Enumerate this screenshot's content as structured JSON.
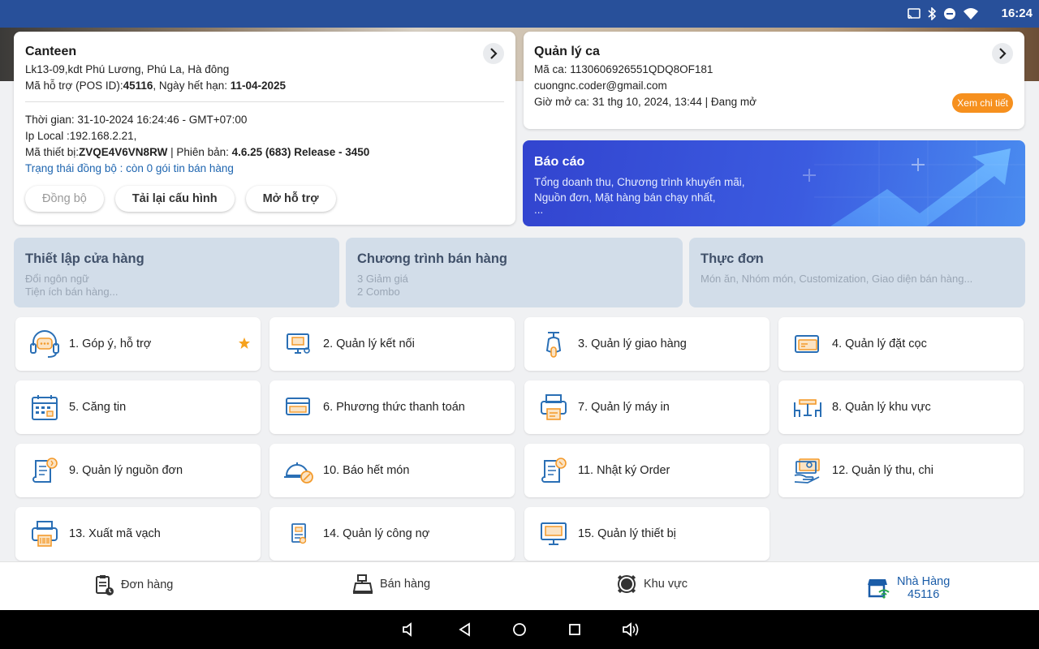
{
  "status": {
    "time": "16:24"
  },
  "canteen": {
    "title": "Canteen",
    "address": "Lk13-09,kdt Phú Lương,  Phú La,  Hà đông",
    "support_prefix": "Mã hỗ trợ (POS ID):",
    "support_id": "45116",
    "expiry_prefix": ", Ngày hết hạn: ",
    "expiry": "11-04-2025",
    "time_line": "Thời gian: 31-10-2024 16:24:46 - GMT+07:00",
    "ip_line": "Ip Local :192.168.2.21,",
    "device_prefix": "Mã thiết bị:",
    "device_id": "ZVQE4V6VN8RW",
    "version_prefix": " | Phiên bản: ",
    "version": "4.6.25 (683) Release - 3450",
    "sync_status": "Trạng thái đồng bộ : còn 0 gói tin bán hàng",
    "buttons": {
      "sync": "Đồng bộ",
      "reload": "Tải lại cấu hình",
      "support": "Mở hỗ trợ"
    }
  },
  "shift": {
    "title": "Quản lý ca",
    "code": "Mã ca: 1130606926551QDQ8OF181",
    "email": "cuongnc.coder@gmail.com",
    "opened": "Giờ mở ca: 31 thg 10, 2024, 13:44 | Đang mở",
    "detail_button": "Xem chi tiết"
  },
  "report": {
    "title": "Báo cáo",
    "line1": "Tổng doanh thu, Chương trình khuyến mãi,",
    "line2": "Nguồn đơn, Mặt hàng bán chạy nhất,",
    "line3": "..."
  },
  "tiles": [
    {
      "title": "Thiết lập cửa hàng",
      "sub1": "Đổi ngôn ngữ",
      "sub2": "Tiện ích bán hàng..."
    },
    {
      "title": "Chương trình bán hàng",
      "sub1": "3 Giảm giá",
      "sub2": "2 Combo"
    },
    {
      "title": "Thực đơn",
      "sub1": "Món ăn,  Nhóm món,  Customization,  Giao diện bán hàng...",
      "sub2": ""
    }
  ],
  "menu": [
    {
      "label": "1. Góp ý, hỗ trợ",
      "icon": "headset-icon"
    },
    {
      "label": "2. Quản lý kết nối",
      "icon": "monitor-connection-icon"
    },
    {
      "label": "3. Quản lý giao hàng",
      "icon": "scooter-icon"
    },
    {
      "label": "4. Quản lý đặt cọc",
      "icon": "deposit-card-icon"
    },
    {
      "label": "5. Căng tin",
      "icon": "calendar-icon"
    },
    {
      "label": "6. Phương thức thanh toán",
      "icon": "payment-card-icon"
    },
    {
      "label": "7. Quản lý máy in",
      "icon": "printer-icon"
    },
    {
      "label": "8. Quản lý khu vực",
      "icon": "table-chairs-icon"
    },
    {
      "label": "9. Quản lý nguồn đơn",
      "icon": "order-source-icon"
    },
    {
      "label": "10. Báo hết món",
      "icon": "cloche-cancel-icon"
    },
    {
      "label": "11. Nhật ký Order",
      "icon": "order-log-icon"
    },
    {
      "label": "12. Quản lý thu, chi",
      "icon": "cash-hand-icon"
    },
    {
      "label": "13. Xuất mã vạch",
      "icon": "barcode-printer-icon"
    },
    {
      "label": "14. Quản lý công nợ",
      "icon": "debt-document-icon"
    },
    {
      "label": "15. Quản lý thiết bị",
      "icon": "device-monitor-icon"
    }
  ],
  "bottom_nav": {
    "orders": "Đơn hàng",
    "sales": "Bán hàng",
    "area": "Khu vực",
    "store_line1": "Nhà Hàng",
    "store_line2": "45116"
  },
  "colors": {
    "status_bar": "#28509a",
    "accent": "#1a5ca8",
    "orange": "#f6901e",
    "tile_bg": "#d2dde9"
  }
}
